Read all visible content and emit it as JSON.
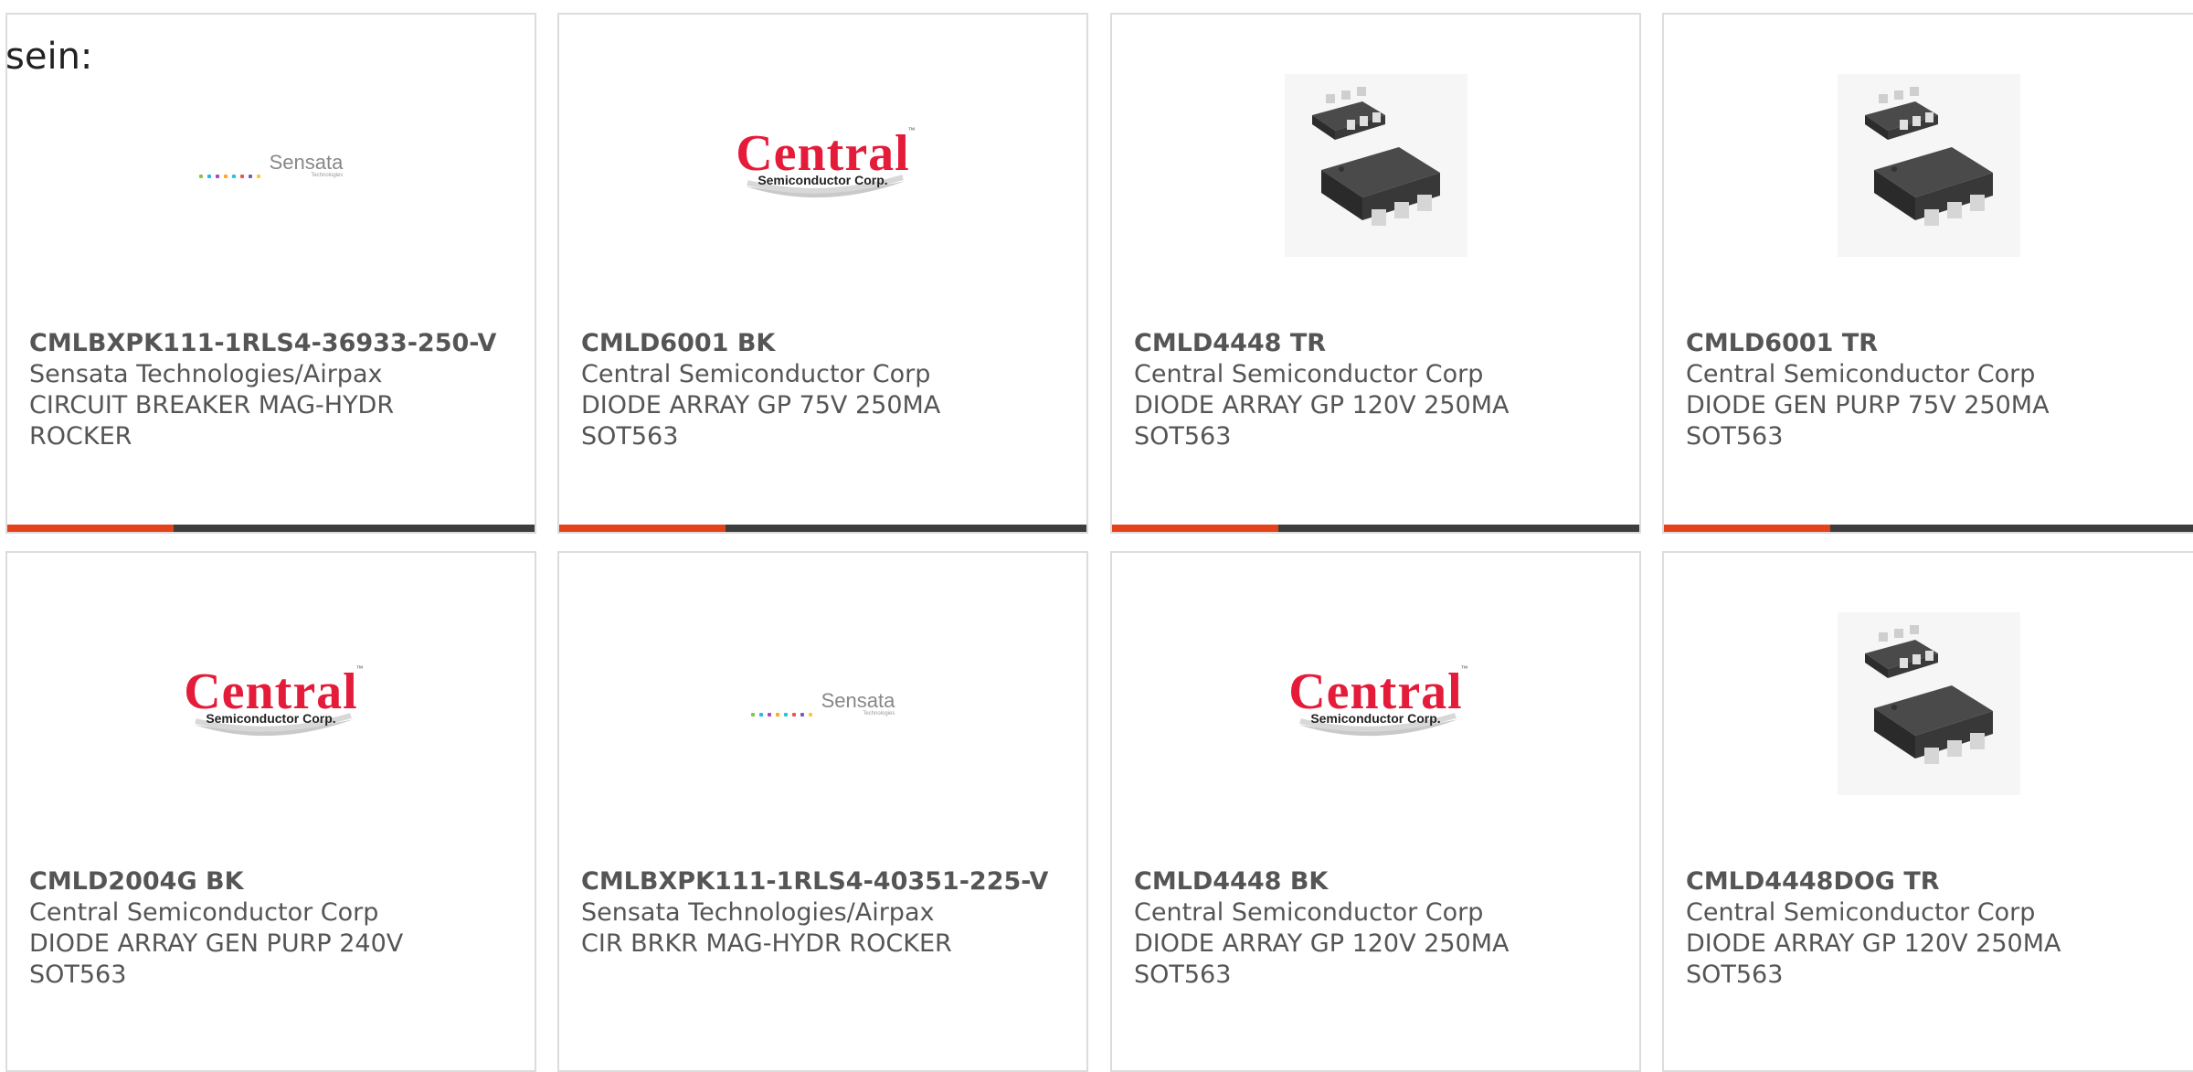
{
  "intro_text": "sein:",
  "brand_colors": {
    "accent": "#e5411b",
    "bar": "#3d3d3d",
    "central_red": "#e41c3a"
  },
  "products": [
    {
      "part_number": "CMLBXPK111-1RLS4-36933-250-V",
      "manufacturer": "Sensata Technologies/Airpax",
      "description_line1": "CIRCUIT BREAKER MAG-HYDR",
      "description_line2": "ROCKER",
      "image": "sensata-logo",
      "logo_word": "Sensata",
      "logo_sub": "Technologies"
    },
    {
      "part_number": "CMLD6001 BK",
      "manufacturer": "Central Semiconductor Corp",
      "description_line1": "DIODE ARRAY GP 75V 250MA",
      "description_line2": "SOT563",
      "image": "central-logo",
      "logo_word": "Central",
      "logo_sub": "Semiconductor Corp.",
      "logo_tm": "™"
    },
    {
      "part_number": "CMLD4448 TR",
      "manufacturer": "Central Semiconductor Corp",
      "description_line1": "DIODE ARRAY GP 120V 250MA",
      "description_line2": "SOT563",
      "image": "sot563-package"
    },
    {
      "part_number": "CMLD6001 TR",
      "manufacturer": "Central Semiconductor Corp",
      "description_line1": "DIODE GEN PURP 75V 250MA",
      "description_line2": "SOT563",
      "image": "sot563-package"
    },
    {
      "part_number": "CMLD2004G BK",
      "manufacturer": "Central Semiconductor Corp",
      "description_line1": "DIODE ARRAY GEN PURP 240V",
      "description_line2": "SOT563",
      "image": "central-logo",
      "logo_word": "Central",
      "logo_sub": "Semiconductor Corp.",
      "logo_tm": "™"
    },
    {
      "part_number": "CMLBXPK111-1RLS4-40351-225-V",
      "manufacturer": "Sensata Technologies/Airpax",
      "description_line1": "CIR BRKR MAG-HYDR ROCKER",
      "description_line2": "",
      "image": "sensata-logo",
      "logo_word": "Sensata",
      "logo_sub": "Technologies"
    },
    {
      "part_number": "CMLD4448 BK",
      "manufacturer": "Central Semiconductor Corp",
      "description_line1": "DIODE ARRAY GP 120V 250MA",
      "description_line2": "SOT563",
      "image": "central-logo",
      "logo_word": "Central",
      "logo_sub": "Semiconductor Corp.",
      "logo_tm": "™"
    },
    {
      "part_number": "CMLD4448DOG TR",
      "manufacturer": "Central Semiconductor Corp",
      "description_line1": "DIODE ARRAY GP 120V 250MA",
      "description_line2": "SOT563",
      "image": "sot563-package"
    }
  ]
}
